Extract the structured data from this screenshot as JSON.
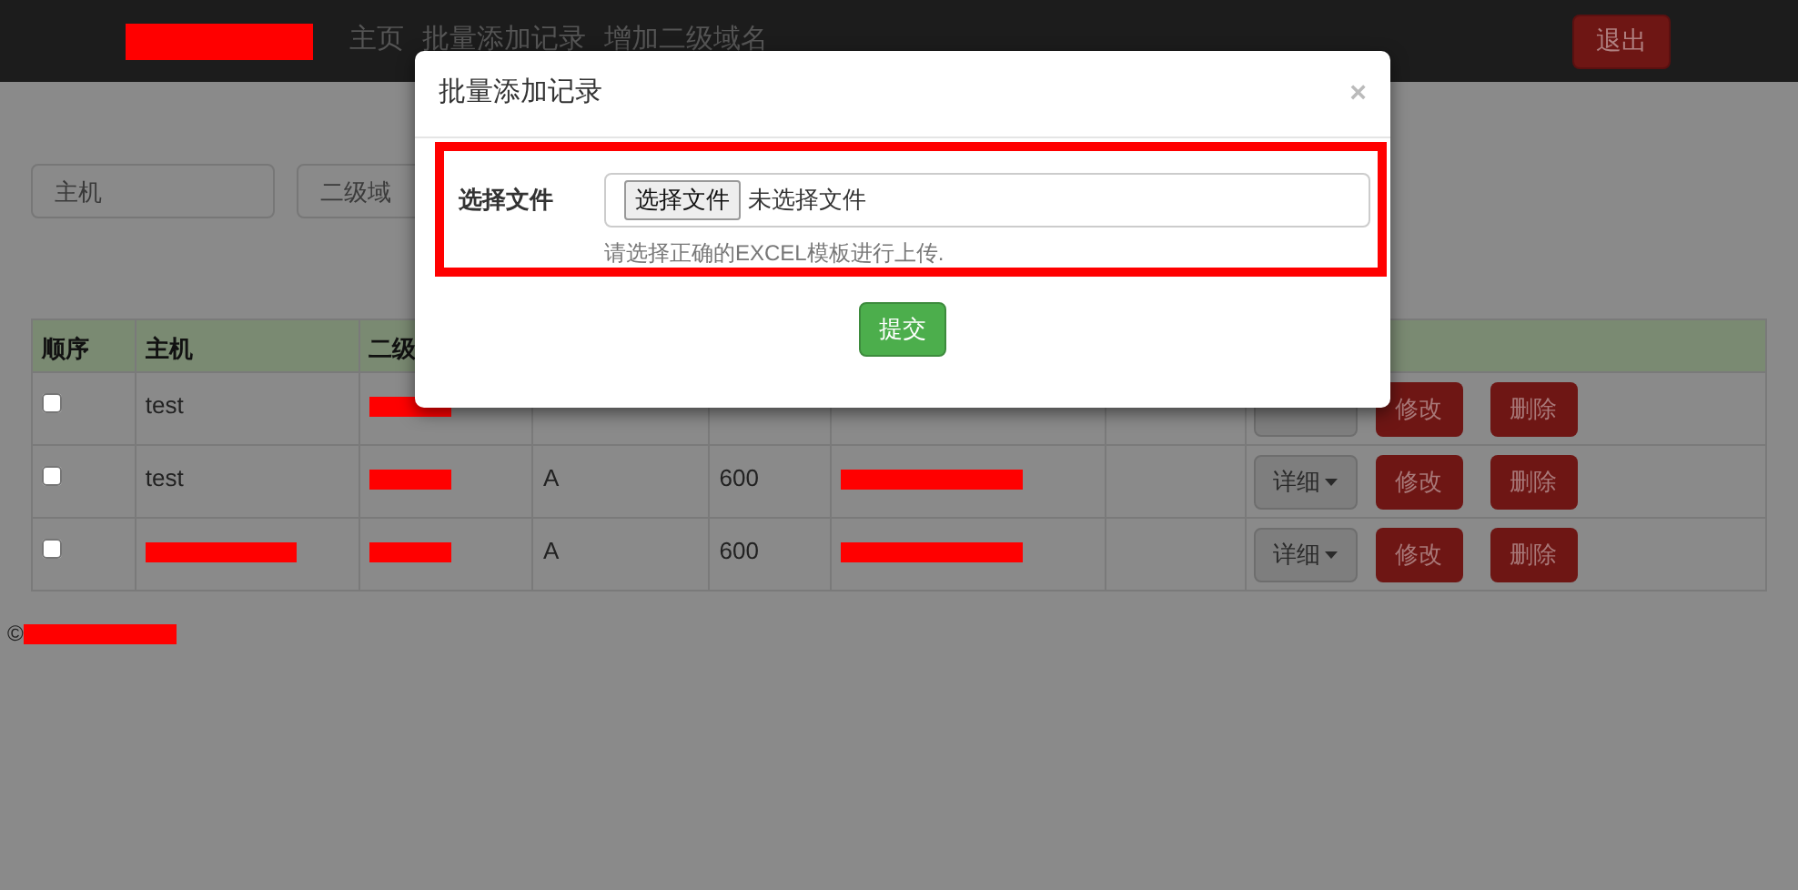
{
  "navbar": {
    "brand": {
      "redacted": true
    },
    "links": [
      "主页",
      "批量添加记录",
      "增加二级域名"
    ],
    "logout": "退出"
  },
  "filters": [
    {
      "placeholder": "主机"
    },
    {
      "placeholder": "二级域"
    }
  ],
  "table": {
    "columns": [
      "顺序",
      "主机",
      "二级"
    ],
    "rows": [
      {
        "checked": false,
        "cells": [
          {
            "kind": "text",
            "text": "test"
          },
          {
            "kind": "redacted"
          },
          {
            "kind": "blank"
          },
          {
            "kind": "blank"
          },
          {
            "kind": "blank"
          },
          {
            "kind": "blank"
          }
        ],
        "actions": {
          "edit": "修改",
          "delete": "删除"
        }
      },
      {
        "checked": false,
        "cells": [
          {
            "kind": "text",
            "text": "test"
          },
          {
            "kind": "redacted"
          },
          {
            "kind": "text",
            "text": "A"
          },
          {
            "kind": "text",
            "text": "600"
          },
          {
            "kind": "redacted"
          },
          {
            "kind": "blank"
          }
        ],
        "actions": {
          "detail": "详细",
          "edit": "修改",
          "delete": "删除"
        }
      },
      {
        "checked": false,
        "cells": [
          {
            "kind": "redacted"
          },
          {
            "kind": "redacted"
          },
          {
            "kind": "text",
            "text": "A"
          },
          {
            "kind": "text",
            "text": "600"
          },
          {
            "kind": "redacted"
          },
          {
            "kind": "blank"
          }
        ],
        "actions": {
          "detail": "详细",
          "edit": "修改",
          "delete": "删除"
        }
      }
    ]
  },
  "footer": {
    "symbol": "©",
    "redacted": true
  },
  "modal": {
    "title": "批量添加记录",
    "close": "×",
    "highlighted": true,
    "field_label": "选择文件",
    "file_button": "选择文件",
    "file_status": "未选择文件",
    "help": "请选择正确的EXCEL模板进行上传.",
    "submit": "提交"
  }
}
